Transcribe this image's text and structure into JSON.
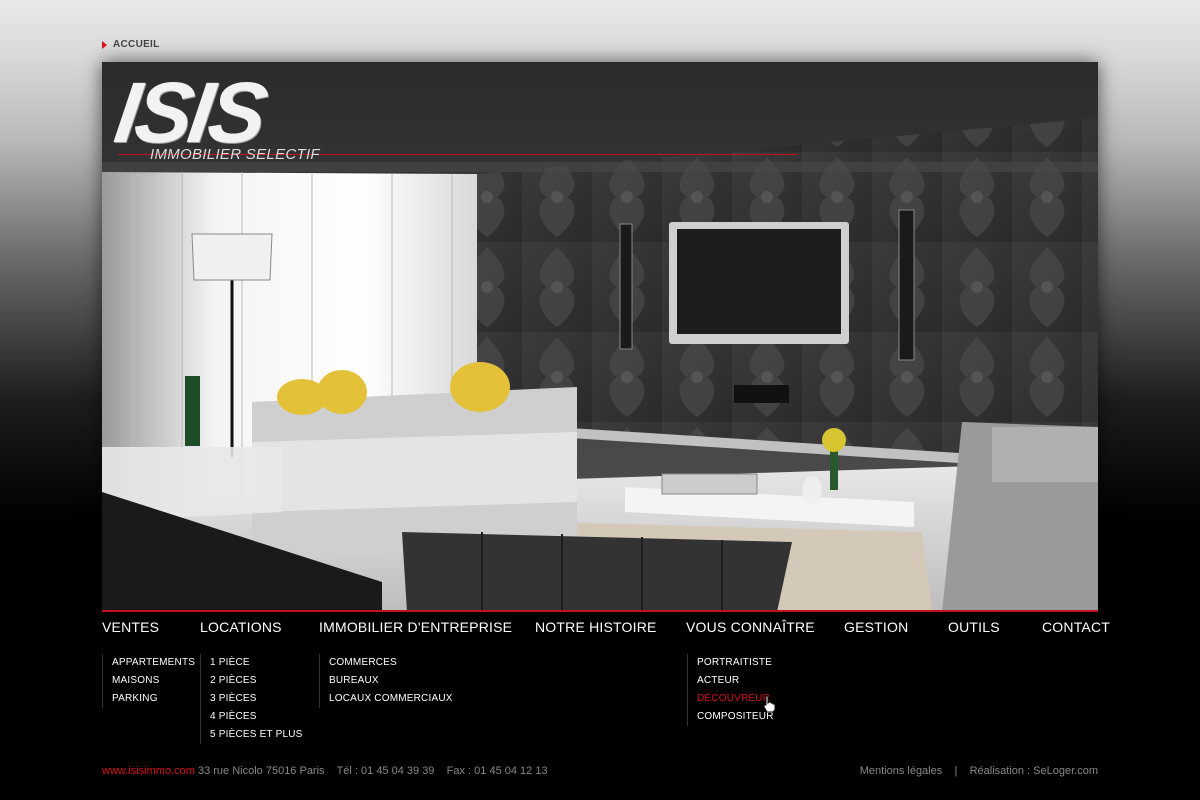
{
  "breadcrumb": {
    "label": "ACCUEIL"
  },
  "logo": {
    "title": "ISIS",
    "subtitle": "IMMOBILIER SELECTIF"
  },
  "nav": {
    "items": [
      {
        "label": "VENTES"
      },
      {
        "label": "LOCATIONS"
      },
      {
        "label": "IMMOBILIER D'ENTREPRISE"
      },
      {
        "label": "NOTRE HISTOIRE"
      },
      {
        "label": "VOUS CONNAÎTRE"
      },
      {
        "label": "GESTION"
      },
      {
        "label": "OUTILS"
      },
      {
        "label": "CONTACT"
      }
    ]
  },
  "submenus": {
    "ventes": [
      "APPARTEMENTS",
      "MAISONS",
      "PARKING"
    ],
    "locations": [
      "1 PIÈCE",
      "2 PIÈCES",
      "3 PIÈCES",
      "4 PIÈCES",
      "5 PIÈCES ET PLUS"
    ],
    "entreprise": [
      "COMMERCES",
      "BUREAUX",
      "LOCAUX COMMERCIAUX"
    ],
    "connaitre": [
      "PORTRAITISTE",
      "ACTEUR",
      "DÉCOUVREUR",
      "COMPOSITEUR"
    ]
  },
  "footer": {
    "url": "www.isisimmo.com",
    "address": "33 rue Nicolo 75016 Paris",
    "tel": "Tél : 01 45 04 39 39",
    "fax": "Fax : 01 45 04 12 13",
    "legal": "Mentions légales",
    "separator": "|",
    "credit": "Réalisation : SeLoger.com"
  },
  "colors": {
    "accent": "#d8101a",
    "background": "#000000"
  }
}
